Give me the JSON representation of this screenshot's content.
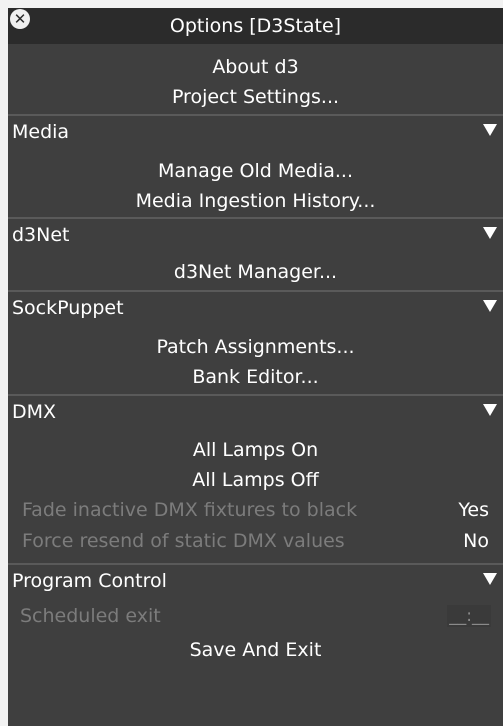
{
  "window": {
    "title": "Options [D3State]",
    "close_icon": "close-icon"
  },
  "top_items": [
    "About d3",
    "Project Settings..."
  ],
  "sections": {
    "media": {
      "label": "Media",
      "items": [
        "Manage Old Media...",
        "Media Ingestion History..."
      ]
    },
    "d3net": {
      "label": "d3Net",
      "items": [
        "d3Net Manager..."
      ]
    },
    "sockpuppet": {
      "label": "SockPuppet",
      "items": [
        "Patch Assignments...",
        "Bank Editor..."
      ]
    },
    "dmx": {
      "label": "DMX",
      "items": [
        "All Lamps On",
        "All Lamps Off"
      ],
      "options": [
        {
          "label": "Fade inactive DMX fixtures to black",
          "value": "Yes"
        },
        {
          "label": "Force resend of static DMX values",
          "value": "No"
        }
      ]
    },
    "program_control": {
      "label": "Program Control",
      "scheduled_exit_label": "Scheduled exit",
      "scheduled_exit_value": "__:__",
      "save_and_exit": "Save And Exit"
    }
  },
  "colors": {
    "panel_bg": "#3f3f3f",
    "titlebar_bg": "#2b2b2b",
    "text": "#ffffff",
    "disabled_text": "#7c7c7c"
  }
}
